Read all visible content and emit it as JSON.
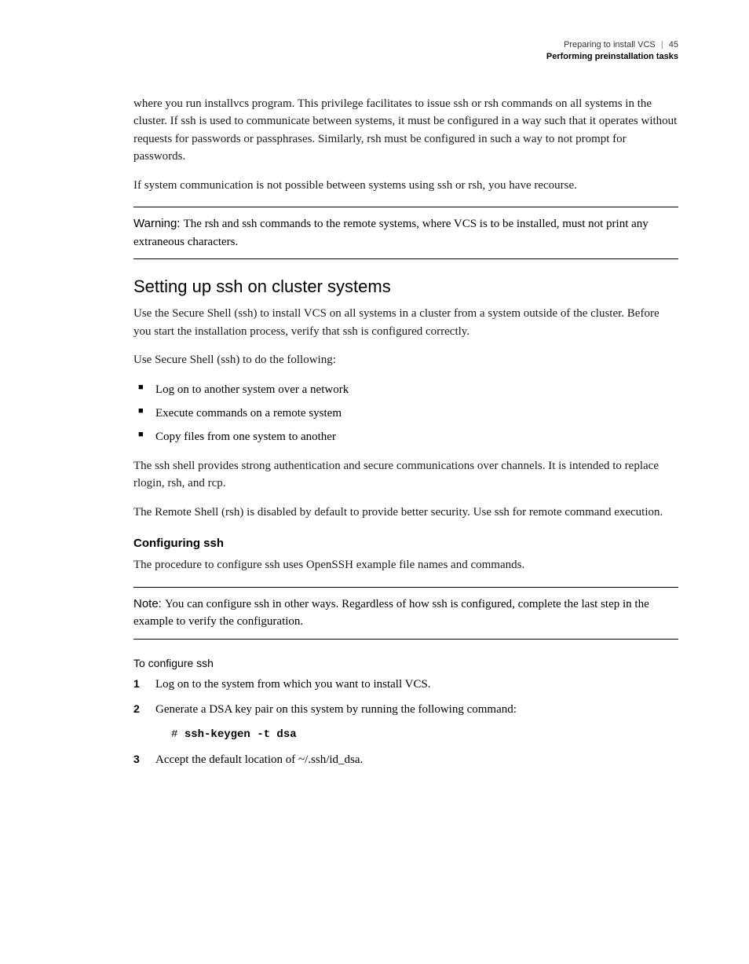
{
  "header": {
    "breadcrumb": "Preparing to install VCS",
    "page_number": "45",
    "section": "Performing preinstallation tasks"
  },
  "paragraphs": {
    "intro1": "where you run installvcs program. This privilege facilitates to issue ssh or rsh commands on all systems in the cluster. If ssh is used to communicate between systems, it must be configured in a way such that it operates without requests for passwords or passphrases. Similarly, rsh must be configured in such a way to not prompt for passwords.",
    "intro2": "If system communication is not possible between systems using ssh or rsh, you have recourse.",
    "warning_label": "Warning: ",
    "warning_text": "The rsh and ssh commands to the remote systems, where VCS is to be installed, must not print any extraneous characters.",
    "heading1": "Setting up ssh on cluster systems",
    "p3": "Use the Secure Shell (ssh) to install VCS on all systems in a cluster from a system outside of the cluster. Before you start the installation process, verify that ssh is configured correctly.",
    "p4": "Use Secure Shell (ssh) to do the following:",
    "bullets": [
      "Log on to another system over a network",
      "Execute commands on a remote system",
      "Copy files from one system to another"
    ],
    "p5": "The ssh shell provides strong authentication and secure communications over channels. It is intended to replace rlogin, rsh, and rcp.",
    "p6": "The Remote Shell (rsh) is disabled by default to provide better security. Use ssh for remote command execution.",
    "heading2": "Configuring ssh",
    "p7": "The procedure to configure ssh uses OpenSSH example file names and commands.",
    "note_label": "Note: ",
    "note_text": "You can configure ssh in other ways. Regardless of how ssh is configured, complete the last step in the example to verify the configuration.",
    "procedure_title": "To configure ssh",
    "steps": [
      "Log on to the system from which you want to install VCS.",
      "Generate a DSA key pair on this system by running the following command:",
      "Accept the default location of ~/.ssh/id_dsa."
    ],
    "code_prompt": "# ",
    "code_cmd": "ssh-keygen -t dsa"
  }
}
